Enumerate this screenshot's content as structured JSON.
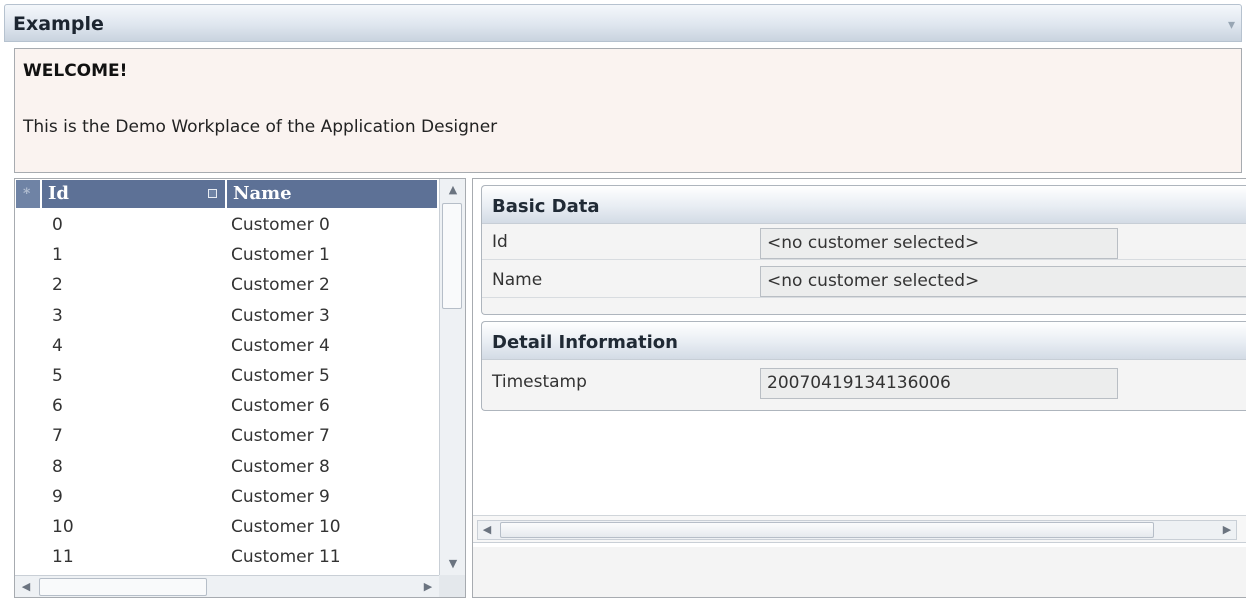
{
  "window": {
    "title": "Example"
  },
  "welcome": {
    "heading": "WELCOME!",
    "text": "This is the Demo Workplace of the Application Designer"
  },
  "grid": {
    "columns": {
      "select": "*",
      "id": "Id",
      "name": "Name"
    },
    "rows": [
      {
        "id": "0",
        "name": "Customer 0"
      },
      {
        "id": "1",
        "name": "Customer 1"
      },
      {
        "id": "2",
        "name": "Customer 2"
      },
      {
        "id": "3",
        "name": "Customer 3"
      },
      {
        "id": "4",
        "name": "Customer 4"
      },
      {
        "id": "5",
        "name": "Customer 5"
      },
      {
        "id": "6",
        "name": "Customer 6"
      },
      {
        "id": "7",
        "name": "Customer 7"
      },
      {
        "id": "8",
        "name": "Customer 8"
      },
      {
        "id": "9",
        "name": "Customer 9"
      },
      {
        "id": "10",
        "name": "Customer 10"
      },
      {
        "id": "11",
        "name": "Customer 11"
      }
    ]
  },
  "basic_data": {
    "title": "Basic Data",
    "id_label": "Id",
    "id_value": "<no customer selected>",
    "name_label": "Name",
    "name_value": "<no customer selected>"
  },
  "detail": {
    "title": "Detail Information",
    "timestamp_label": "Timestamp",
    "timestamp_value": "20070419134136006"
  },
  "icons": {
    "window_menu": "chevron-down-icon",
    "sort": "sort-indicator-icon",
    "scroll_up": "arrow-up-icon",
    "scroll_down": "arrow-down-icon",
    "scroll_left": "arrow-left-icon",
    "scroll_right": "arrow-right-icon"
  },
  "colors": {
    "grid_header": "#5d7196",
    "welcome_bg": "#faf3f0"
  }
}
